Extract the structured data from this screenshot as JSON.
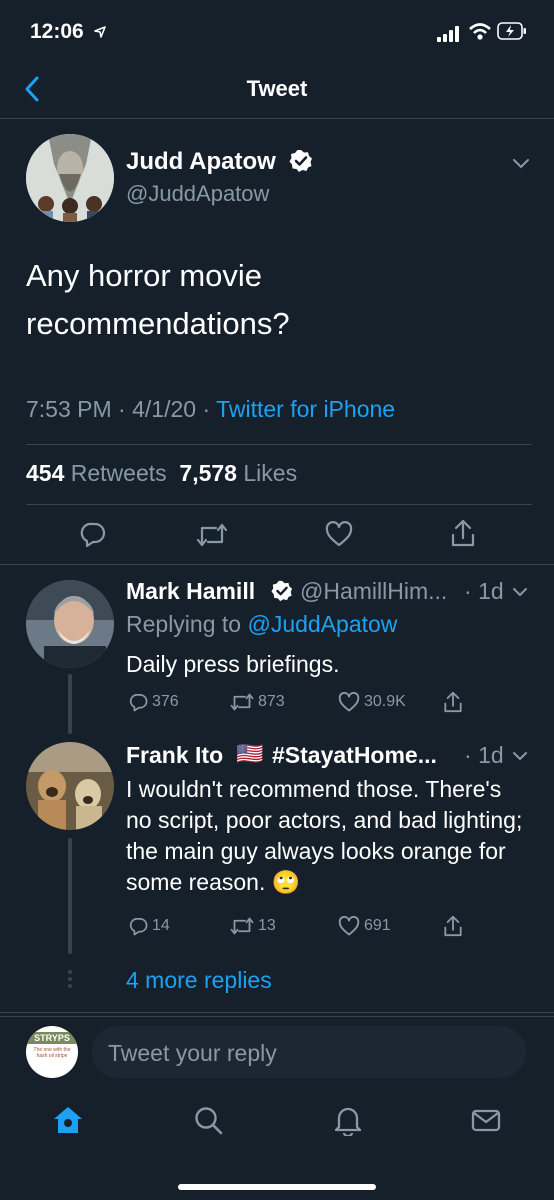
{
  "status_bar": {
    "time": "12:06"
  },
  "nav": {
    "title": "Tweet"
  },
  "tweet": {
    "author_name": "Judd Apatow",
    "author_handle": "@JuddApatow",
    "text": "Any horror movie recommendations?",
    "time": "7:53 PM",
    "date": "4/1/20",
    "source": "Twitter for iPhone",
    "retweets_count": "454",
    "retweets_label": "Retweets",
    "likes_count": "7,578",
    "likes_label": "Likes"
  },
  "replies": [
    {
      "author_name": "Mark Hamill",
      "author_handle": "@HamillHim...",
      "age": "1d",
      "replying_to_label": "Replying to",
      "replying_to_handle": "@JuddApatow",
      "text": "Daily press briefings.",
      "reply_count": "376",
      "retweet_count": "873",
      "like_count": "30.9K"
    },
    {
      "author_name": "Frank Ito",
      "flag": "🇺🇸",
      "hashtag": "#StayatHome...",
      "age": "1d",
      "text": "I wouldn't recommend those. There's no script, poor actors, and bad lighting; the main guy always looks orange for some reason. 🙄",
      "reply_count": "14",
      "retweet_count": "13",
      "like_count": "691"
    }
  ],
  "more_replies": "4 more replies",
  "composer": {
    "avatar_text_top": "STRYPS",
    "avatar_text_bottom": "The one with the hash oil stripe",
    "placeholder": "Tweet your reply"
  },
  "colors": {
    "background": "#15202b",
    "accent": "#1da1f2",
    "muted": "#8899a6",
    "divider": "#38444d"
  }
}
